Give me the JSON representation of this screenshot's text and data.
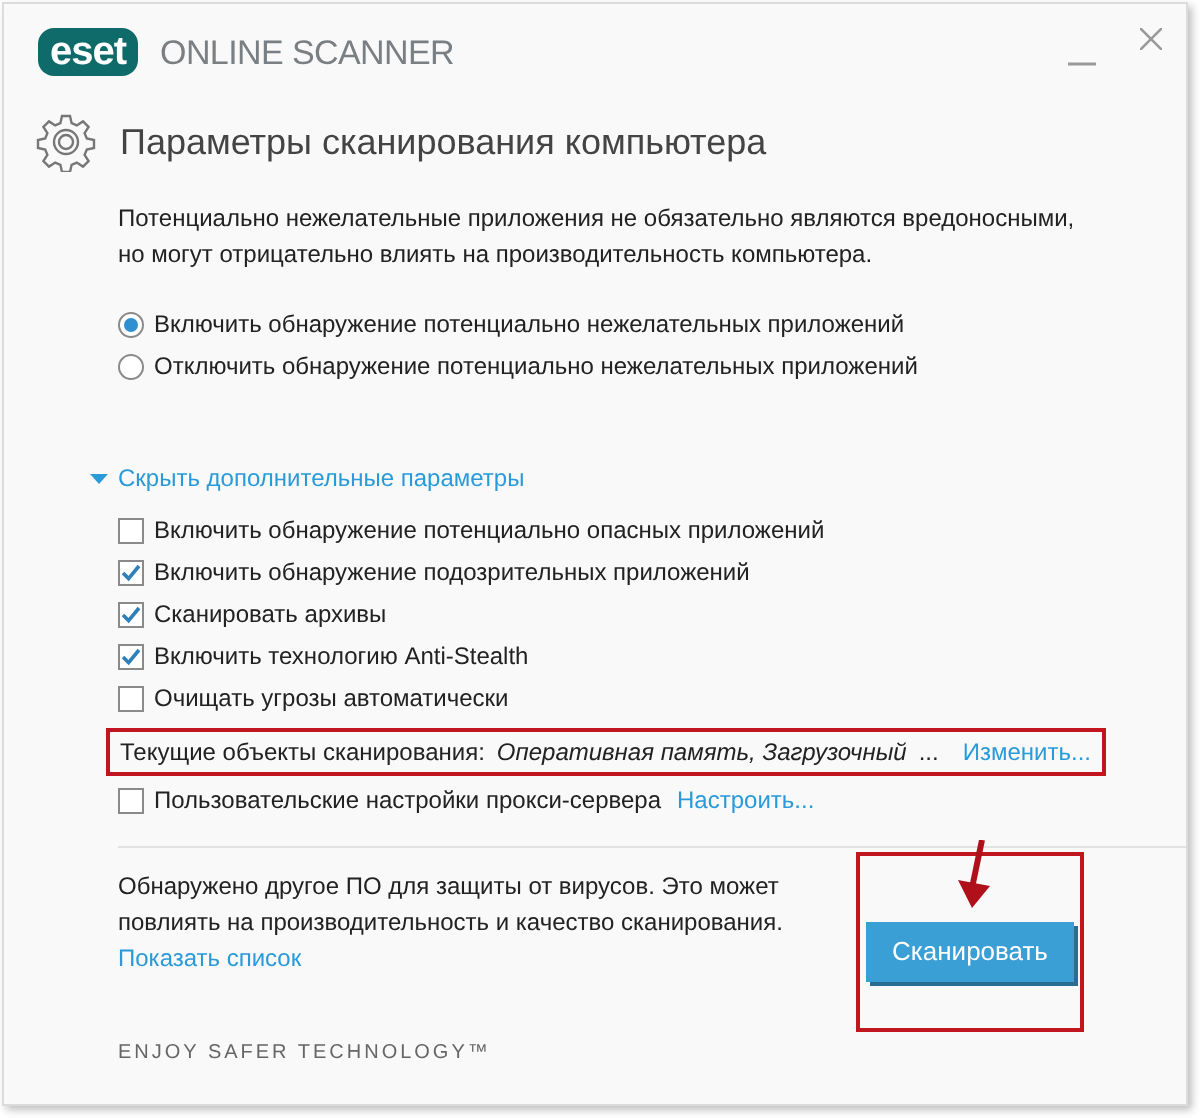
{
  "window": {
    "logo": "eset",
    "title": "ONLINE SCANNER"
  },
  "heading": "Параметры сканирования компьютера",
  "description": "Потенциально нежелательные приложения не обязательно являются вредоносными, но могут отрицательно влиять на производительность компьютера.",
  "radios": [
    {
      "label": "Включить обнаружение потенциально нежелательных приложений",
      "selected": true
    },
    {
      "label": "Отключить обнаружение потенциально нежелательных приложений",
      "selected": false
    }
  ],
  "advanced_toggle": {
    "label": "Скрыть дополнительные параметры",
    "expanded": true
  },
  "checkboxes": [
    {
      "label": "Включить обнаружение потенциально опасных приложений",
      "checked": false
    },
    {
      "label": "Включить обнаружение подозрительных приложений",
      "checked": true
    },
    {
      "label": "Сканировать архивы",
      "checked": true
    },
    {
      "label": "Включить технологию Anti-Stealth",
      "checked": true
    },
    {
      "label": "Очищать угрозы автоматически",
      "checked": false
    }
  ],
  "scan_targets": {
    "label": "Текущие объекты сканирования:",
    "value": "Оперативная память, Загрузочный",
    "ellipsis": "...",
    "link": "Изменить...",
    "highlighted": true
  },
  "proxy": {
    "label": "Пользовательские настройки прокси-сервера",
    "checked": false,
    "link": "Настроить..."
  },
  "notice": {
    "text": "Обнаружено другое ПО для защиты от вирусов. Это может повлиять на производительность и качество сканирования.",
    "link": "Показать список"
  },
  "scan_button": {
    "label": "Сканировать",
    "highlighted": true
  },
  "footer": "ENJOY SAFER TECHNOLOGY™"
}
